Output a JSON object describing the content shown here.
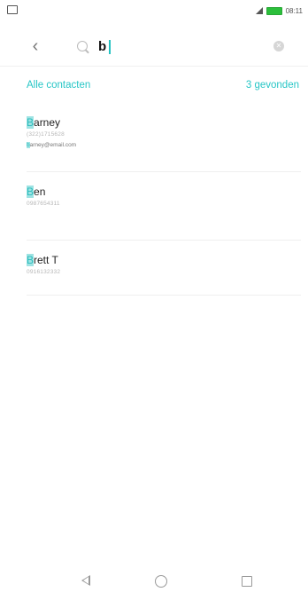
{
  "status_bar": {
    "time": "08:11",
    "battery_color": "#2bbf3b"
  },
  "search": {
    "value": "b",
    "placeholder": ""
  },
  "filter": {
    "scope_label": "Alle contacten",
    "result_count": "3 gevonden"
  },
  "accent_color": "#27c6c6",
  "contacts": [
    {
      "name_hl": "B",
      "name_rest": "arney",
      "phone": "(322)1715628",
      "email_hl": "b",
      "email_rest": "arney@email.com"
    },
    {
      "name_hl": "B",
      "name_rest": "en",
      "phone": "0987654311"
    },
    {
      "name_hl": "B",
      "name_rest": "rett T",
      "phone": "0916132332"
    }
  ],
  "nav": {
    "back_icon": "triangle-back-icon",
    "home_icon": "circle-home-icon",
    "recent_icon": "square-recent-icon"
  }
}
